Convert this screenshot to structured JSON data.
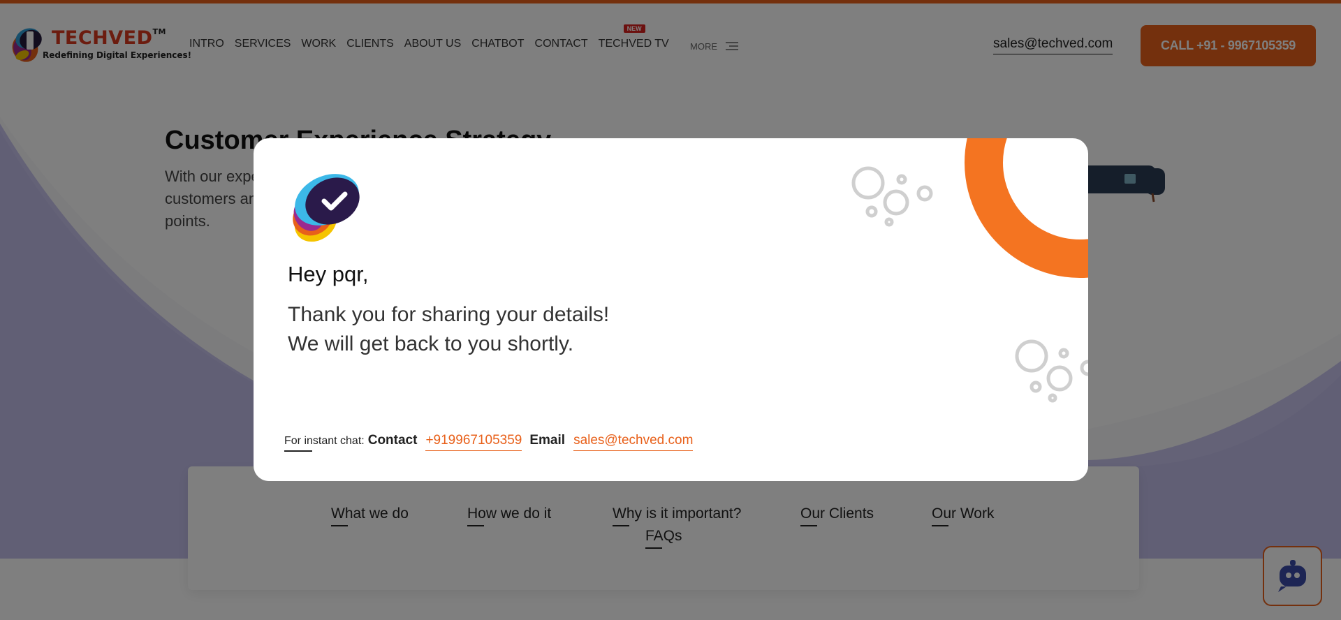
{
  "header": {
    "brand": "TECHVED",
    "trademark": "TM",
    "tagline": "Redefining Digital Experiences!",
    "nav": [
      "INTRO",
      "SERVICES",
      "WORK",
      "CLIENTS",
      "ABOUT US",
      "CHATBOT",
      "CONTACT",
      "TECHVED TV"
    ],
    "new_badge": "NEW",
    "more_label": "MORE",
    "email": "sales@techved.com",
    "call_label": "CALL +91 - 9967105359"
  },
  "hero": {
    "title": "Customer Experience Strategy",
    "description": "With our expertise, we help you understand your customers and design experiences across touch points."
  },
  "section_tabs": [
    "What we do",
    "How we do it",
    "Why is it important?",
    "Our Clients",
    "Our Work",
    "FAQs"
  ],
  "modal": {
    "greeting": "Hey pqr,",
    "line1": "Thank you for sharing your details!",
    "line2": "We will get back to you shortly.",
    "instant_label": "For instant chat:",
    "contact_label": "Contact",
    "phone": "+919967105359",
    "email_label": "Email",
    "email": "sales@techved.com"
  },
  "colors": {
    "accent": "#e8601a",
    "ring": "#f47421",
    "violet": "#c7c3ec"
  },
  "icons": {
    "chat_fab": "chatbot-robot-icon",
    "more": "hamburger-icon",
    "modal_logo": "checkmark-logo-icon"
  }
}
